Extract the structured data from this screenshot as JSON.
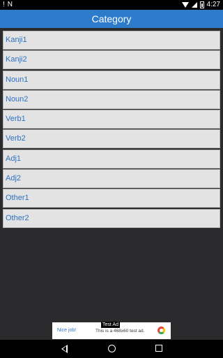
{
  "status_bar": {
    "left_icons": [
      "!",
      "N"
    ],
    "time": "4:27"
  },
  "app_bar": {
    "title": "Category"
  },
  "categories": [
    {
      "label": "Kanji1"
    },
    {
      "label": "Kanji2"
    },
    {
      "label": "Noun1"
    },
    {
      "label": "Noun2"
    },
    {
      "label": "Verb1"
    },
    {
      "label": "Verb2"
    },
    {
      "label": "Adj1"
    },
    {
      "label": "Adj2"
    },
    {
      "label": "Other1"
    },
    {
      "label": "Other2"
    }
  ],
  "ad": {
    "badge": "Test Ad",
    "cta": "Nice job!",
    "text": "This is a 468x60 test ad."
  }
}
